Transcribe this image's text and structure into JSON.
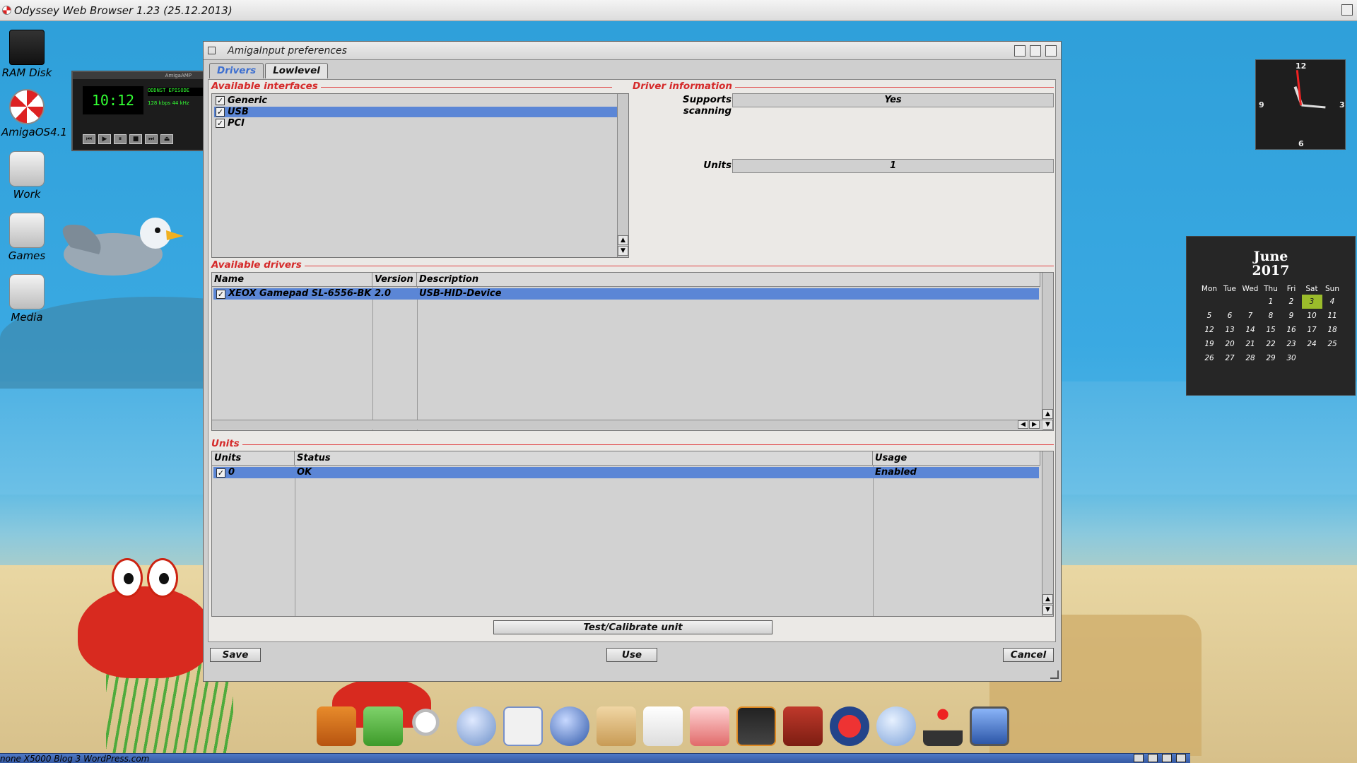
{
  "screen": {
    "title": "Odyssey Web Browser 1.23 (25.12.2013)"
  },
  "desktop_icons": [
    {
      "label": "RAM Disk"
    },
    {
      "label": "AmigaOS4.1"
    },
    {
      "label": "Work"
    },
    {
      "label": "Games"
    },
    {
      "label": "Media"
    }
  ],
  "amp": {
    "app_name": "AmigaAMP",
    "time": "10:12",
    "track": "ODDNST EPISODE",
    "kbps": "128",
    "khz": "44",
    "kbps_label": "kbps",
    "khz_label": "kHz"
  },
  "clock": {
    "n12": "12",
    "n3": "3",
    "n6": "6",
    "n9": "9"
  },
  "calendar": {
    "month": "June",
    "year": "2017",
    "days": [
      "Mon",
      "Tue",
      "Wed",
      "Thu",
      "Fri",
      "Sat",
      "Sun"
    ],
    "weeks": [
      [
        "",
        "",
        "",
        "1",
        "2",
        "3",
        "4"
      ],
      [
        "5",
        "6",
        "7",
        "8",
        "9",
        "10",
        "11"
      ],
      [
        "12",
        "13",
        "14",
        "15",
        "16",
        "17",
        "18"
      ],
      [
        "19",
        "20",
        "21",
        "22",
        "23",
        "24",
        "25"
      ],
      [
        "26",
        "27",
        "28",
        "29",
        "30",
        "",
        ""
      ]
    ],
    "today": "3"
  },
  "window": {
    "title": "AmigaInput preferences",
    "tabs": [
      {
        "label": "Drivers",
        "active": true
      },
      {
        "label": "Lowlevel",
        "active": false
      }
    ],
    "available_interfaces": {
      "section_label": "Available interfaces",
      "items": [
        {
          "label": "Generic",
          "checked": true,
          "selected": false
        },
        {
          "label": "USB",
          "checked": true,
          "selected": true
        },
        {
          "label": "PCI",
          "checked": true,
          "selected": false
        }
      ]
    },
    "driver_information": {
      "section_label": "Driver information",
      "supports_scanning_label": "Supports scanning",
      "supports_scanning_value": "Yes",
      "units_label": "Units",
      "units_value": "1"
    },
    "available_drivers": {
      "section_label": "Available drivers",
      "columns": [
        "Name",
        "Version",
        "Description"
      ],
      "rows": [
        {
          "name": "XEOX Gamepad SL-6556-BK",
          "version": "2.0",
          "description": "USB-HID-Device",
          "checked": true
        }
      ]
    },
    "units": {
      "section_label": "Units",
      "columns": [
        "Units",
        "Status",
        "Usage"
      ],
      "rows": [
        {
          "unit": "0",
          "status": "OK",
          "usage": "Enabled",
          "checked": true
        }
      ]
    },
    "test_button": "Test/Calibrate unit",
    "save_button": "Save",
    "use_button": "Use",
    "cancel_button": "Cancel"
  },
  "dock_icons": [
    "video-player-icon",
    "notepad-icon",
    "search-icon",
    "orb-icon",
    "shell-icon",
    "ball-icon",
    "file-finder-icon",
    "pdf-viewer-icon",
    "installer-icon",
    "uae-icon",
    "bag-icon",
    "game-icon",
    "media-player-icon",
    "joystick-icon",
    "screen-prefs-icon"
  ],
  "taskbar": {
    "text": "none X5000 Blog 3 WordPress.com"
  },
  "colors": {
    "selection": "#5b86d6",
    "section_label": "#d52a2a",
    "active_tab": "#3d6fd0"
  }
}
